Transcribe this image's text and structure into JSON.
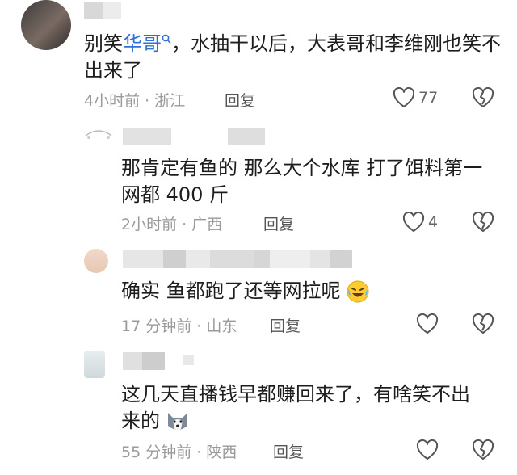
{
  "comments": [
    {
      "text_prefix": "别笑",
      "text_highlight": "华哥",
      "text_rest": "，水抽干以后，大表哥和李维刚也笑不出来了",
      "time": "4小时前",
      "location": "浙江",
      "reply_label": "回复",
      "likes": "77"
    },
    {
      "text": "那肯定有鱼的 那么大个水库 打了饵料第一网都 400 斤",
      "time": "2小时前",
      "location": "广西",
      "reply_label": "回复",
      "likes": "4"
    },
    {
      "text": "确实 鱼都跑了还等网拉呢",
      "emoji": "rolling-laughing-emoji",
      "time": "17 分钟前",
      "location": "山东",
      "reply_label": "回复",
      "likes": ""
    },
    {
      "text": "这几天直播钱早都赚回来了，有啥笑不出来的",
      "emoji": "husky-dog-emoji",
      "time": "55 分钟前",
      "location": "陕西",
      "reply_label": "回复",
      "likes": ""
    }
  ],
  "separator": "·",
  "icons": {
    "search": "search-icon",
    "like": "heart-icon",
    "dislike": "broken-heart-icon"
  },
  "colors": {
    "highlight": "#2f6fd6",
    "meta": "#9a9a9a",
    "icon": "#555555"
  }
}
